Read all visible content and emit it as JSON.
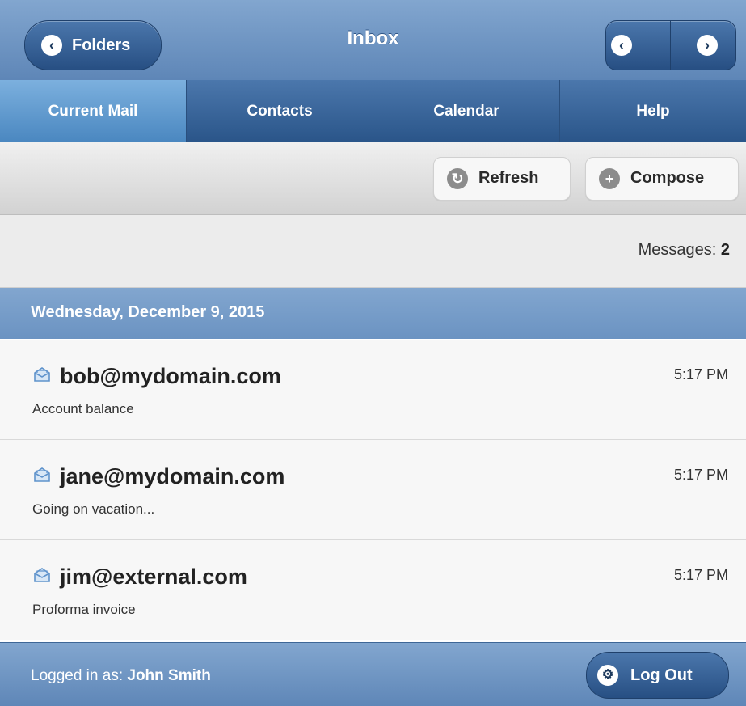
{
  "header": {
    "title": "Inbox",
    "folders_label": "Folders"
  },
  "tabs": [
    {
      "label": "Current Mail",
      "active": true
    },
    {
      "label": "Contacts"
    },
    {
      "label": "Calendar"
    },
    {
      "label": "Help"
    }
  ],
  "toolbar": {
    "refresh_label": "Refresh",
    "compose_label": "Compose"
  },
  "messages_count": {
    "label": "Messages:",
    "count": "2"
  },
  "date_header": "Wednesday, December 9, 2015",
  "messages": [
    {
      "sender": "bob@mydomain.com",
      "subject": "Account balance",
      "time": "5:17 PM"
    },
    {
      "sender": "jane@mydomain.com",
      "subject": "Going on vacation...",
      "time": "5:17 PM"
    },
    {
      "sender": "jim@external.com",
      "subject": "Proforma invoice",
      "time": "5:17 PM"
    }
  ],
  "footer": {
    "logged_in_label": "Logged in as:",
    "user_name": "John Smith",
    "logout_label": "Log Out"
  },
  "icons": {
    "back": "chevron-left-icon",
    "prev": "chevron-left-icon",
    "next": "chevron-right-icon",
    "refresh": "refresh-icon",
    "compose": "plus-icon",
    "message": "envelope-icon",
    "logout": "gear-icon"
  },
  "colors": {
    "bar_blue": "#6b93c2",
    "button_blue": "#274f83",
    "active_tab": "#5b97cc"
  }
}
